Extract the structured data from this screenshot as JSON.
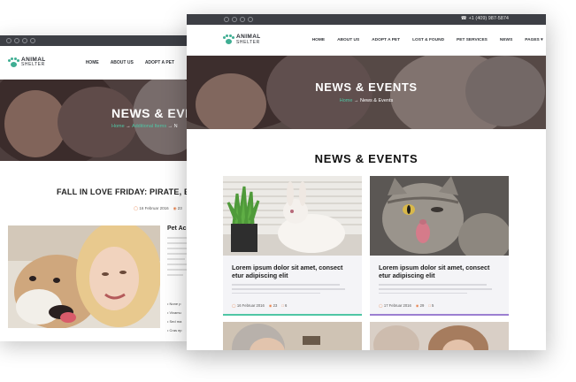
{
  "back_window": {
    "logo": {
      "line1": "ANIMAL",
      "line2": "SHELTER"
    },
    "menu": [
      "HOME",
      "ABOUT US",
      "ADOPT A PET"
    ],
    "hero_title": "NEWS & EVE",
    "breadcrumb": {
      "home": "Home",
      "sep1": "→",
      "middle": "Additional Items",
      "sep2": "→",
      "current": "N"
    },
    "post_title": "FALL IN LOVE FRIDAY: PIRATE, EIG",
    "post_meta": {
      "date": "16 Februar 2016",
      "views": "23"
    },
    "side_title": "Pet Ac",
    "bullets": [
      "None p",
      "Vivamu",
      "Sed ma",
      "Cras ep"
    ]
  },
  "front_window": {
    "phone": "+1 (409) 987-5874",
    "logo": {
      "line1": "ANIMAL",
      "line2": "SHELTER"
    },
    "menu": [
      "HOME",
      "ABOUT US",
      "ADOPT A PET",
      "LOST & FOUND",
      "PET SERVICES",
      "NEWS",
      "PAGES ▾"
    ],
    "hero_title": "NEWS & EVENTS",
    "breadcrumb": {
      "home": "Home",
      "sep": "→",
      "current": "News & Events"
    },
    "section_title": "NEWS & EVENTS",
    "cards": [
      {
        "title": "Lorem ipsum dolor sit amet, consect etur adipiscing elit",
        "date": "16 Februar 2016",
        "views": "23",
        "comments": "6",
        "accent": "#4fc6a5"
      },
      {
        "title": "Lorem ipsum dolor sit amet, consect etur adipiscing elit",
        "date": "17 Februar 2016",
        "views": "29",
        "comments": "5",
        "accent": "#9b7fd1"
      }
    ]
  },
  "colors": {
    "topbar": "#3d3f45",
    "accent_green": "#4fc6a5",
    "accent_orange": "#e8804a",
    "accent_purple": "#9b7fd1"
  },
  "icons": [
    "facebook-icon",
    "twitter-icon",
    "google-plus-icon",
    "instagram-icon",
    "phone-icon",
    "paw-logo-icon",
    "calendar-icon",
    "eye-icon",
    "comment-icon"
  ]
}
